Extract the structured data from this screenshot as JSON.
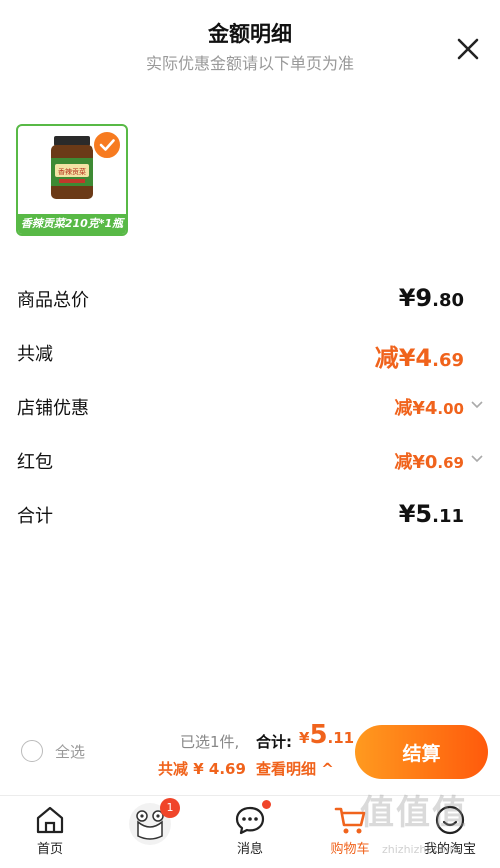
{
  "header": {
    "title": "金额明细",
    "subtitle": "实际优惠金额请以下单页为准"
  },
  "product": {
    "label": "香辣贡菜210克*1瓶",
    "jar_label": "香辣贡菜",
    "selected": true
  },
  "rows": {
    "total_price": {
      "label": "商品总价",
      "currency": "¥",
      "int": "9",
      "dec": ".80"
    },
    "total_discount": {
      "label": "共减",
      "prefix": "减",
      "currency": "¥",
      "int": "4",
      "dec": ".69"
    },
    "store_discount": {
      "label": "店铺优惠",
      "prefix": "减",
      "currency": "¥",
      "int": "4",
      "dec": ".00"
    },
    "red_packet": {
      "label": "红包",
      "prefix": "减",
      "currency": "¥",
      "int": "0",
      "dec": ".69"
    },
    "sum": {
      "label": "合计",
      "currency": "¥",
      "int": "5",
      "dec": ".11"
    }
  },
  "footer": {
    "select_all": "全选",
    "selected_count": "已选1件,",
    "total_label": "合计:",
    "total_currency": "¥",
    "total_int": "5",
    "total_dec": ".11",
    "saved_text": "共减 ¥ 4.69",
    "detail_link": "查看明细 ^",
    "checkout": "结算"
  },
  "tabs": [
    {
      "label": "首页",
      "icon": "home-icon"
    },
    {
      "label": "",
      "icon": "mascot-icon",
      "badge": "1"
    },
    {
      "label": "消息",
      "icon": "message-icon"
    },
    {
      "label": "购物车",
      "icon": "cart-icon",
      "active": true
    },
    {
      "label": "我的淘宝",
      "icon": "profile-icon"
    }
  ],
  "watermark": {
    "text": "值值值",
    "sub": "zhizhizhi.com"
  },
  "colors": {
    "accent": "#f0631c",
    "green": "#58b946",
    "badge": "#f0452a"
  }
}
